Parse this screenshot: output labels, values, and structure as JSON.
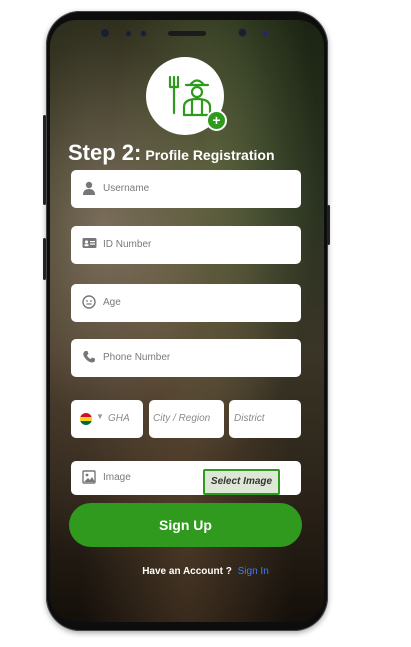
{
  "header": {
    "step_label": "Step 2:",
    "step_subtitle": "Profile Registration"
  },
  "form": {
    "username_placeholder": "Username",
    "id_number_placeholder": "ID Number",
    "age_placeholder": "Age",
    "phone_placeholder": "Phone Number",
    "country_code": "GHA",
    "city_placeholder": "City / Region",
    "district_placeholder": "District",
    "image_label": "Image",
    "select_image_label": "Select Image"
  },
  "actions": {
    "signup_label": "Sign Up",
    "have_account_text": "Have an Account ?",
    "signin_link": "Sign In"
  },
  "colors": {
    "accent_green": "#2f9a1d",
    "link_blue": "#3a7bff"
  },
  "icons": [
    "farmer-avatar-icon",
    "plus-icon",
    "user-icon",
    "id-card-icon",
    "age-icon",
    "phone-icon",
    "ghana-flag-icon",
    "chevron-down-icon",
    "image-icon"
  ]
}
